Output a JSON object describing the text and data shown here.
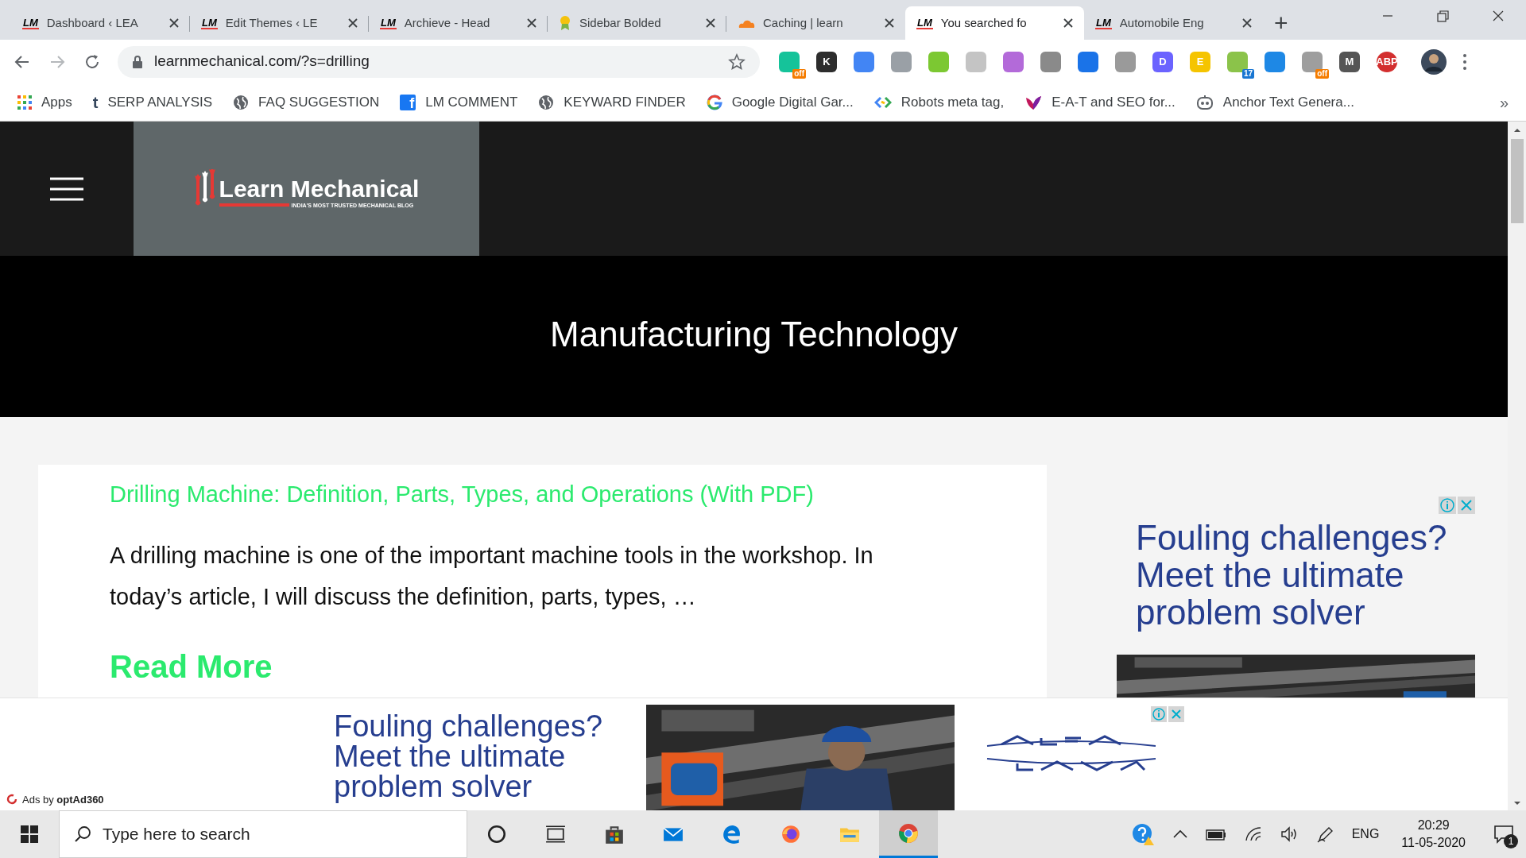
{
  "tabs": [
    {
      "kind": "lm",
      "favicon_text": "LM",
      "title": "Dashboard ‹ LEA",
      "selected": false
    },
    {
      "kind": "lm",
      "favicon_text": "LM",
      "title": "Edit Themes ‹ LE",
      "selected": false
    },
    {
      "kind": "lm",
      "favicon_text": "LM",
      "title": "Archieve - Head",
      "selected": false
    },
    {
      "kind": "ribbon",
      "title": "Sidebar Bolded",
      "selected": false
    },
    {
      "kind": "cloud",
      "title": "Caching | learn",
      "selected": false
    },
    {
      "kind": "lm",
      "favicon_text": "LM",
      "title": "You searched fo",
      "selected": true
    },
    {
      "kind": "lm",
      "favicon_text": "LM",
      "title": "Automobile Eng",
      "selected": false
    }
  ],
  "new_tab": "+",
  "address_bar": {
    "url": "learnmechanical.com/?s=drilling"
  },
  "extensions": [
    {
      "color": "#15c39a",
      "badge": "off"
    },
    {
      "color": "#2d2d2d",
      "glyph": "K"
    },
    {
      "color": "#4285f4"
    },
    {
      "color": "#9aa0a6"
    },
    {
      "color": "#7cc832"
    },
    {
      "color": "#c4c4c4"
    },
    {
      "color": "#b36ad9"
    },
    {
      "color": "#8a8a8a"
    },
    {
      "color": "#1a73e8"
    },
    {
      "color": "#9a9a9a"
    },
    {
      "color": "#6b63ff",
      "glyph": "D"
    },
    {
      "color": "#f5c400",
      "glyph": "E"
    },
    {
      "color": "#8bc34a",
      "badge": "17"
    },
    {
      "color": "#1e88e5"
    },
    {
      "color": "#9e9e9e",
      "badge": "off"
    },
    {
      "color": "#555555",
      "glyph": "M"
    },
    {
      "color": "#d32f2f",
      "glyph": "ABP"
    }
  ],
  "bookmarks": [
    {
      "kind": "apps",
      "label": "Apps"
    },
    {
      "kind": "char",
      "icon_text": "t",
      "label": "SERP ANALYSIS"
    },
    {
      "kind": "globe",
      "label": "FAQ SUGGESTION"
    },
    {
      "kind": "facebook",
      "icon_text": "f",
      "label": "LM COMMENT"
    },
    {
      "kind": "globe",
      "label": "KEYWARD FINDER"
    },
    {
      "kind": "google",
      "label": "Google Digital Gar..."
    },
    {
      "kind": "code",
      "label": "Robots meta tag,"
    },
    {
      "kind": "bird",
      "label": "E-A-T and SEO for..."
    },
    {
      "kind": "robot",
      "label": "Anchor Text Genera..."
    }
  ],
  "bookmarks_more": "»",
  "site_header": {
    "logo_title": "Learn Mechanical",
    "logo_tagline": "INDIA'S MOST TRUSTED MECHANICAL BLOG"
  },
  "page_title": "Manufacturing Technology",
  "results": [
    {
      "title": "Drilling Machine: Definition, Parts, Types, and Operations (With PDF)",
      "excerpt_lines": [
        "A drilling machine is one of the important machine tools in the workshop. In",
        "today’s article, I will discuss the definition, parts, types, …"
      ],
      "read_more": "Read More"
    }
  ],
  "sidebar_ad": {
    "headline_lines": [
      "Fouling challenges?",
      "Meet the ultimate",
      "problem solver"
    ]
  },
  "bottom_ad": {
    "headline_lines": [
      "Fouling challenges?",
      "Meet the ultimate",
      "problem solver"
    ]
  },
  "ads_by": "Ads by **optAd360**",
  "taskbar": {
    "search_placeholder": "Type here to search",
    "apps": [
      {
        "kind": "cortana",
        "selected": false
      },
      {
        "kind": "taskview",
        "selected": false
      },
      {
        "kind": "store",
        "selected": false
      },
      {
        "kind": "mail",
        "selected": false
      },
      {
        "kind": "edge",
        "selected": false
      },
      {
        "kind": "firefox",
        "selected": false
      },
      {
        "kind": "explorer",
        "selected": false
      },
      {
        "kind": "chrome",
        "selected": true
      }
    ],
    "language": "ENG",
    "time": "20:29",
    "date": "11-05-2020",
    "notifications": "1"
  }
}
